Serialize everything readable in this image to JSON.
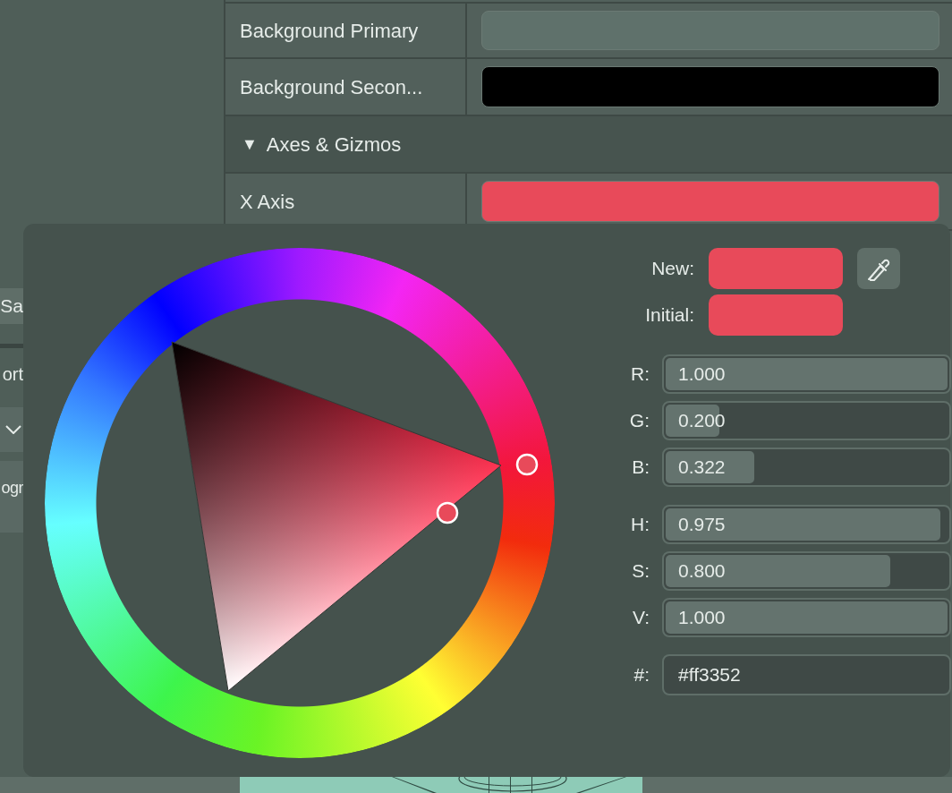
{
  "left_panel": {
    "button": "Sa",
    "label": "ort",
    "label_2": "ogr"
  },
  "properties": [
    {
      "kind": "color",
      "label": "Background Primary",
      "color": "#5f716b"
    },
    {
      "kind": "color",
      "label": "Background Secon...",
      "color": "#000000"
    },
    {
      "kind": "section",
      "toggle": "▼",
      "label": "Axes & Gizmos",
      "expanded": true
    },
    {
      "kind": "color",
      "label": "X Axis",
      "color": "#e84a5a"
    }
  ],
  "color_picker": {
    "new": {
      "label": "New:",
      "color": "#e84a5a"
    },
    "initial": {
      "label": "Initial:",
      "color": "#e84a5a"
    },
    "rgb": [
      {
        "label": "R:",
        "value": "1.000",
        "level": 1.0
      },
      {
        "label": "G:",
        "value": "0.200",
        "level": 0.2
      },
      {
        "label": "B:",
        "value": "0.322",
        "level": 0.322
      }
    ],
    "hsv": [
      {
        "label": "H:",
        "value": "0.975",
        "level": 0.975
      },
      {
        "label": "S:",
        "value": "0.800",
        "level": 0.8
      },
      {
        "label": "V:",
        "value": "1.000",
        "level": 1.0
      }
    ],
    "hex": {
      "label": "#:",
      "value": "#ff3352"
    }
  }
}
